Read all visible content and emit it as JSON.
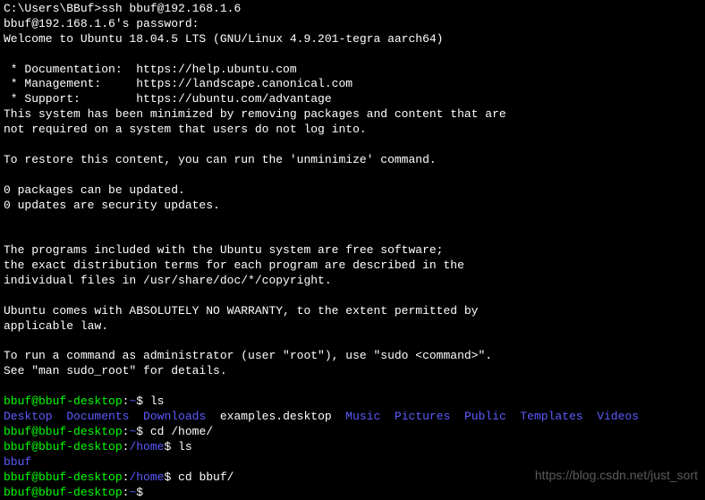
{
  "lines": [
    {
      "segments": [
        {
          "text": "C:\\Users\\BBuf>ssh bbuf@192.168.1.6",
          "cls": "white"
        }
      ]
    },
    {
      "segments": [
        {
          "text": "bbuf@192.168.1.6's password:",
          "cls": "white"
        }
      ]
    },
    {
      "segments": [
        {
          "text": "Welcome to Ubuntu 18.04.5 LTS (GNU/Linux 4.9.201-tegra aarch64)",
          "cls": "white"
        }
      ]
    },
    {
      "blank": true
    },
    {
      "segments": [
        {
          "text": " * Documentation:  https://help.ubuntu.com",
          "cls": "white"
        }
      ]
    },
    {
      "segments": [
        {
          "text": " * Management:     https://landscape.canonical.com",
          "cls": "white"
        }
      ]
    },
    {
      "segments": [
        {
          "text": " * Support:        https://ubuntu.com/advantage",
          "cls": "white"
        }
      ]
    },
    {
      "segments": [
        {
          "text": "This system has been minimized by removing packages and content that are",
          "cls": "white"
        }
      ]
    },
    {
      "segments": [
        {
          "text": "not required on a system that users do not log into.",
          "cls": "white"
        }
      ]
    },
    {
      "blank": true
    },
    {
      "segments": [
        {
          "text": "To restore this content, you can run the 'unminimize' command.",
          "cls": "white"
        }
      ]
    },
    {
      "blank": true
    },
    {
      "segments": [
        {
          "text": "0 packages can be updated.",
          "cls": "white"
        }
      ]
    },
    {
      "segments": [
        {
          "text": "0 updates are security updates.",
          "cls": "white"
        }
      ]
    },
    {
      "blank": true
    },
    {
      "blank": true
    },
    {
      "segments": [
        {
          "text": "The programs included with the Ubuntu system are free software;",
          "cls": "white"
        }
      ]
    },
    {
      "segments": [
        {
          "text": "the exact distribution terms for each program are described in the",
          "cls": "white"
        }
      ]
    },
    {
      "segments": [
        {
          "text": "individual files in /usr/share/doc/*/copyright.",
          "cls": "white"
        }
      ]
    },
    {
      "blank": true
    },
    {
      "segments": [
        {
          "text": "Ubuntu comes with ABSOLUTELY NO WARRANTY, to the extent permitted by",
          "cls": "white"
        }
      ]
    },
    {
      "segments": [
        {
          "text": "applicable law.",
          "cls": "white"
        }
      ]
    },
    {
      "blank": true
    },
    {
      "segments": [
        {
          "text": "To run a command as administrator (user \"root\"), use \"sudo <command>\".",
          "cls": "white"
        }
      ]
    },
    {
      "segments": [
        {
          "text": "See \"man sudo_root\" for details.",
          "cls": "white"
        }
      ]
    },
    {
      "blank": true
    },
    {
      "segments": [
        {
          "text": "bbuf@bbuf-desktop",
          "cls": "green"
        },
        {
          "text": ":",
          "cls": "white"
        },
        {
          "text": "~",
          "cls": "blue"
        },
        {
          "text": "$ ls",
          "cls": "white"
        }
      ]
    },
    {
      "segments": [
        {
          "text": "Desktop",
          "cls": "blue"
        },
        {
          "text": "  ",
          "cls": "white"
        },
        {
          "text": "Documents",
          "cls": "blue"
        },
        {
          "text": "  ",
          "cls": "white"
        },
        {
          "text": "Downloads",
          "cls": "blue"
        },
        {
          "text": "  examples.desktop  ",
          "cls": "white"
        },
        {
          "text": "Music",
          "cls": "blue"
        },
        {
          "text": "  ",
          "cls": "white"
        },
        {
          "text": "Pictures",
          "cls": "blue"
        },
        {
          "text": "  ",
          "cls": "white"
        },
        {
          "text": "Public",
          "cls": "blue"
        },
        {
          "text": "  ",
          "cls": "white"
        },
        {
          "text": "Templates",
          "cls": "blue"
        },
        {
          "text": "  ",
          "cls": "white"
        },
        {
          "text": "Videos",
          "cls": "blue"
        }
      ]
    },
    {
      "segments": [
        {
          "text": "bbuf@bbuf-desktop",
          "cls": "green"
        },
        {
          "text": ":",
          "cls": "white"
        },
        {
          "text": "~",
          "cls": "blue"
        },
        {
          "text": "$ cd /home/",
          "cls": "white"
        }
      ]
    },
    {
      "segments": [
        {
          "text": "bbuf@bbuf-desktop",
          "cls": "green"
        },
        {
          "text": ":",
          "cls": "white"
        },
        {
          "text": "/home",
          "cls": "blue"
        },
        {
          "text": "$ ls",
          "cls": "white"
        }
      ]
    },
    {
      "segments": [
        {
          "text": "bbuf",
          "cls": "blue"
        }
      ]
    },
    {
      "segments": [
        {
          "text": "bbuf@bbuf-desktop",
          "cls": "green"
        },
        {
          "text": ":",
          "cls": "white"
        },
        {
          "text": "/home",
          "cls": "blue"
        },
        {
          "text": "$ cd bbuf/",
          "cls": "white"
        }
      ]
    },
    {
      "segments": [
        {
          "text": "bbuf@bbuf-desktop",
          "cls": "green"
        },
        {
          "text": ":",
          "cls": "white"
        },
        {
          "text": "~",
          "cls": "blue"
        },
        {
          "text": "$ ",
          "cls": "white"
        }
      ]
    }
  ],
  "watermark": "https://blog.csdn.net/just_sort"
}
